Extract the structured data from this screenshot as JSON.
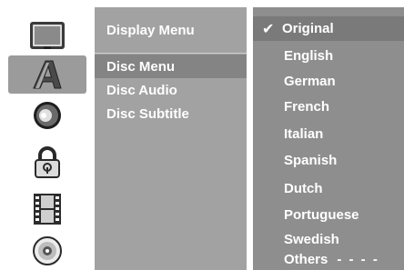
{
  "icons": [
    {
      "name": "display-tv-icon",
      "active": false
    },
    {
      "name": "language-a-icon",
      "active": true
    },
    {
      "name": "audio-speaker-icon",
      "active": false
    },
    {
      "name": "lock-icon",
      "active": false
    },
    {
      "name": "film-icon",
      "active": false
    },
    {
      "name": "disc-icon",
      "active": false
    }
  ],
  "menu": {
    "header": "Display Menu",
    "items": [
      {
        "label": "Disc Menu",
        "selected": true
      },
      {
        "label": "Disc Audio",
        "selected": false
      },
      {
        "label": "Disc Subtitle",
        "selected": false
      }
    ]
  },
  "options": {
    "current": "Original",
    "items": [
      "English",
      "German",
      "French",
      "Italian",
      "Spanish",
      "Dutch",
      "Portuguese",
      "Swedish"
    ],
    "others_label": "Others",
    "others_value": "- - - -"
  },
  "colors": {
    "menu_bg": "#a2a2a2",
    "menu_selected": "#848484",
    "options_bg": "#8e8e8e",
    "icon_active_bg": "#9b9b9b"
  }
}
